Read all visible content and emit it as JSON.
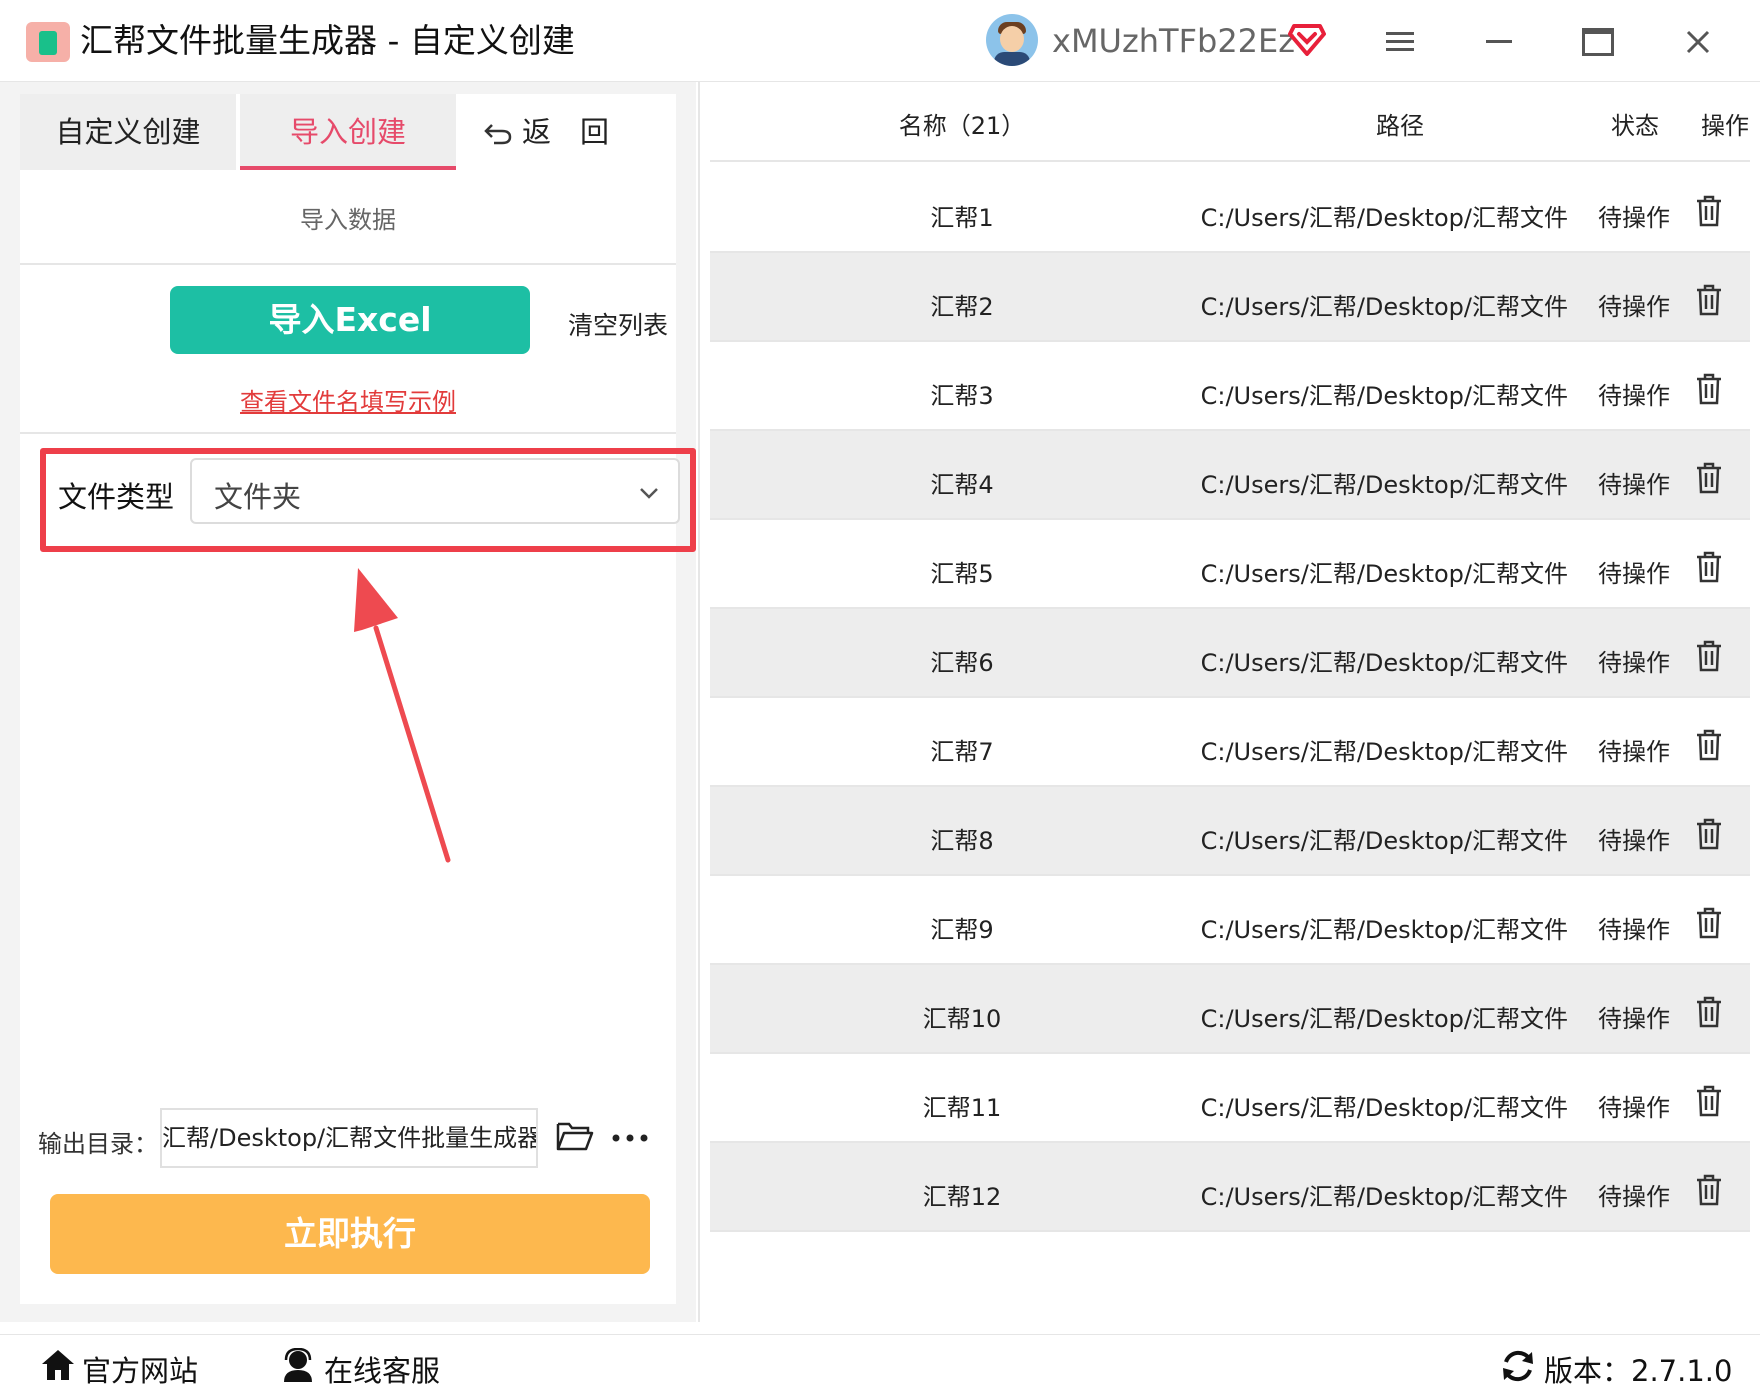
{
  "window": {
    "title": "汇帮文件批量生成器 - 自定义创建",
    "username": "xMUzhTFb22Ez",
    "icons": [
      "app-logo-icon",
      "avatar",
      "vip-diamond-icon",
      "menu-icon",
      "minimize-icon",
      "maximize-icon",
      "close-icon"
    ]
  },
  "left": {
    "tabs": [
      {
        "label": "自定义创建"
      },
      {
        "label": "导入创建"
      }
    ],
    "back_label": "返　回",
    "section_label": "导入数据",
    "import_excel_label": "导入Excel",
    "clear_list_label": "清空列表",
    "example_link": "查看文件名填写示例",
    "file_type": {
      "label": "文件类型",
      "value": "文件夹"
    },
    "output": {
      "label": "输出目录：",
      "value": "汇帮/Desktop/汇帮文件批量生成器"
    },
    "execute_label": "立即执行",
    "colors": {
      "accent_tab": "#e64a6a",
      "import_button": "#1dbfa4",
      "execute_button": "#fdb84e",
      "highlight": "#ee3f4a"
    }
  },
  "table": {
    "headers": {
      "name": "名称（21）",
      "path": "路径",
      "status": "状态",
      "op": "操作"
    },
    "rows": [
      {
        "name": "汇帮1",
        "path": "C:/Users/汇帮/Desktop/汇帮文件",
        "status": "待操作"
      },
      {
        "name": "汇帮2",
        "path": "C:/Users/汇帮/Desktop/汇帮文件",
        "status": "待操作"
      },
      {
        "name": "汇帮3",
        "path": "C:/Users/汇帮/Desktop/汇帮文件",
        "status": "待操作"
      },
      {
        "name": "汇帮4",
        "path": "C:/Users/汇帮/Desktop/汇帮文件",
        "status": "待操作"
      },
      {
        "name": "汇帮5",
        "path": "C:/Users/汇帮/Desktop/汇帮文件",
        "status": "待操作"
      },
      {
        "name": "汇帮6",
        "path": "C:/Users/汇帮/Desktop/汇帮文件",
        "status": "待操作"
      },
      {
        "name": "汇帮7",
        "path": "C:/Users/汇帮/Desktop/汇帮文件",
        "status": "待操作"
      },
      {
        "name": "汇帮8",
        "path": "C:/Users/汇帮/Desktop/汇帮文件",
        "status": "待操作"
      },
      {
        "name": "汇帮9",
        "path": "C:/Users/汇帮/Desktop/汇帮文件",
        "status": "待操作"
      },
      {
        "name": "汇帮10",
        "path": "C:/Users/汇帮/Desktop/汇帮文件",
        "status": "待操作"
      },
      {
        "name": "汇帮11",
        "path": "C:/Users/汇帮/Desktop/汇帮文件",
        "status": "待操作"
      },
      {
        "name": "汇帮12",
        "path": "C:/Users/汇帮/Desktop/汇帮文件",
        "status": "待操作"
      }
    ]
  },
  "footer": {
    "official_site": "官方网站",
    "online_support": "在线客服",
    "version": "版本：2.7.1.0"
  }
}
